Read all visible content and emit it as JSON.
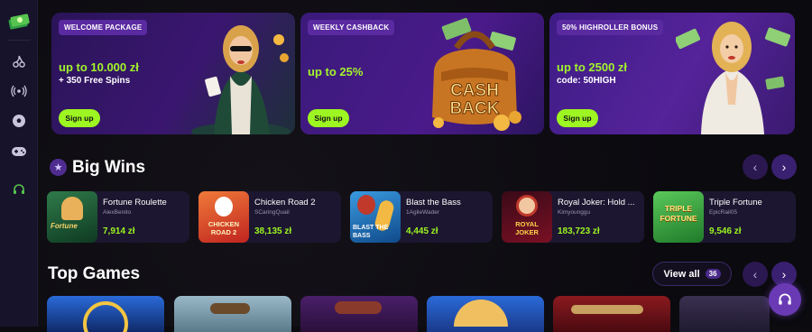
{
  "sidebar": {
    "logo": "cash-stack-logo",
    "items": [
      {
        "icon": "cherries-icon",
        "glyph": "⚘"
      },
      {
        "icon": "live-broadcast-icon",
        "glyph": "((·))"
      },
      {
        "icon": "soccer-ball-icon",
        "glyph": "⚽"
      },
      {
        "icon": "gamepad-icon",
        "glyph": "🎮"
      },
      {
        "icon": "headset-icon",
        "glyph": "🎧"
      }
    ]
  },
  "banners": [
    {
      "tag": "WELCOME PACKAGE",
      "amount": "up to 10.000 zł",
      "sub": "+ 350 Free Spins",
      "button": "Sign up"
    },
    {
      "tag": "WEEKLY CASHBACK",
      "amount": "up to 25%",
      "sub": "",
      "button": "Sign up",
      "art_text_1": "CASH",
      "art_text_2": "BACK"
    },
    {
      "tag": "50% HIGHROLLER BONUS",
      "amount": "up to 2500 zł",
      "sub": "code: 50HIGH",
      "button": "Sign up"
    }
  ],
  "big_wins": {
    "title": "Big Wins",
    "items": [
      {
        "game": "Fortune Roulette",
        "user": "AlexBenito",
        "amount": "7,914 zł",
        "thumb_label": "Fortune",
        "thumb_color": "#1f5a3a"
      },
      {
        "game": "Chicken Road 2",
        "user": "SCaringQuail",
        "amount": "38,135 zł",
        "thumb_label": "CHICKEN ROAD 2",
        "thumb_color": "#d2382c"
      },
      {
        "game": "Blast the Bass",
        "user": "1AgileWader",
        "amount": "4,445 zł",
        "thumb_label": "BLAST THE BASS",
        "thumb_color": "#1e6fb8"
      },
      {
        "game": "Royal Joker: Hold ...",
        "user": "Kimyounggu",
        "amount": "183,723 zł",
        "thumb_label": "ROYAL JOKER",
        "thumb_color": "#b01a2e"
      },
      {
        "game": "Triple Fortune",
        "user": "EpicRail05",
        "amount": "9,546 zł",
        "thumb_label": "TRIPLE FORTUNE",
        "thumb_color": "#2f9a3a"
      }
    ]
  },
  "top_games": {
    "title": "Top Games",
    "view_all_label": "View all",
    "view_all_count": "36",
    "tiles": [
      "#1b3d8f",
      "#6d8fa8",
      "#3d1a55",
      "#1e4a8a",
      "#5a1418",
      "#2a2440"
    ]
  },
  "nav": {
    "prev": "‹",
    "next": "›"
  }
}
